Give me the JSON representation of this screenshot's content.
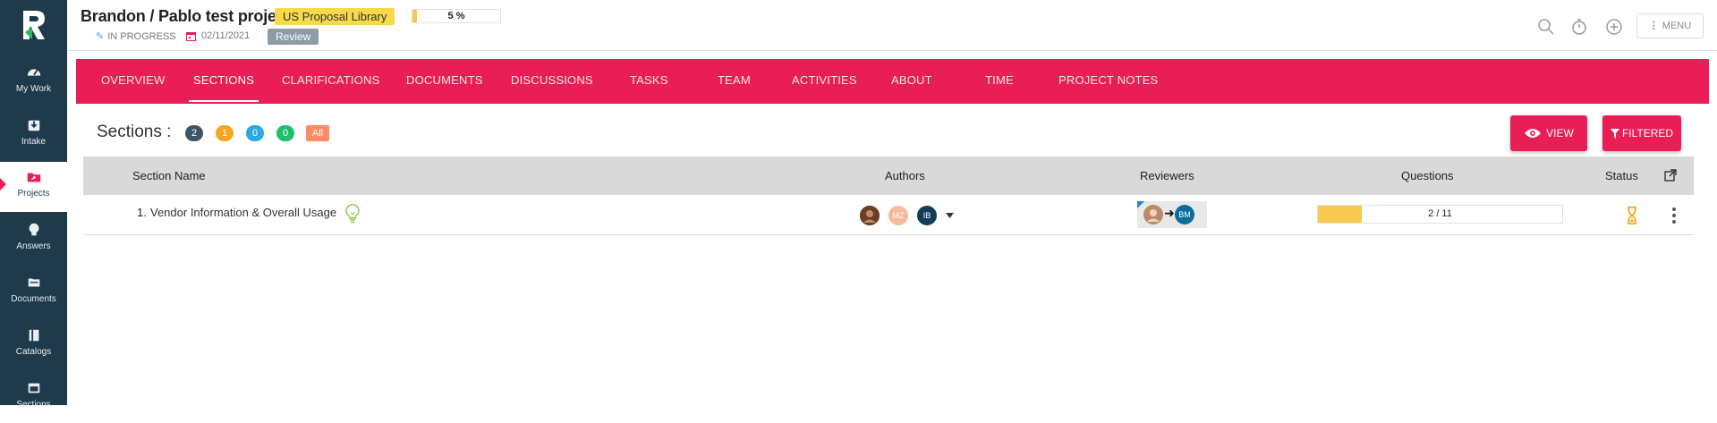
{
  "sidebar": {
    "items": [
      {
        "label": "My Work",
        "icon": "gauge-icon"
      },
      {
        "label": "Intake",
        "icon": "inbox-icon"
      },
      {
        "label": "Projects",
        "icon": "folder-icon"
      },
      {
        "label": "Answers",
        "icon": "lightbulb-icon"
      },
      {
        "label": "Documents",
        "icon": "folders-icon"
      },
      {
        "label": "Catalogs",
        "icon": "catalog-icon"
      },
      {
        "label": "Sections",
        "icon": "sections-icon"
      }
    ]
  },
  "header": {
    "title": "Brandon / Pablo test project",
    "library_badge": "US Proposal Library",
    "progress_text": "5 %",
    "progress_fraction": 0.05,
    "status": "IN PROGRESS",
    "date": "02/11/2021",
    "review_badge": "Review",
    "menu_label": "MENU"
  },
  "tabs": [
    "OVERVIEW",
    "SECTIONS",
    "CLARIFICATIONS",
    "DOCUMENTS",
    "DISCUSSIONS",
    "TASKS",
    "TEAM",
    "ACTIVITIES",
    "ABOUT",
    "TIME",
    "PROJECT NOTES"
  ],
  "active_tab": "SECTIONS",
  "sections_bar": {
    "title": "Sections :",
    "counts": [
      "2",
      "1",
      "0",
      "0"
    ],
    "all_label": "All",
    "view_label": "VIEW",
    "filtered_label": "FILTERED"
  },
  "table": {
    "headers": {
      "section_name": "Section Name",
      "authors": "Authors",
      "reviewers": "Reviewers",
      "questions": "Questions",
      "status": "Status"
    },
    "rows": [
      {
        "number": "1.",
        "name": "Vendor Information & Overall Usage",
        "authors": [
          "",
          "MZ",
          "IB"
        ],
        "reviewer_initials": "BM",
        "questions_text": "2 / 11",
        "questions_fraction": 0.18
      }
    ]
  },
  "colors": {
    "accent": "#e91e57",
    "sidebar": "#1f3a4a",
    "yellow": "#f7c94c",
    "badge_dark": "#3d5566",
    "badge_orange": "#f5a623",
    "badge_blue": "#2aa8e0",
    "badge_green": "#1fbf6a",
    "badge_all": "#ff8a65"
  }
}
